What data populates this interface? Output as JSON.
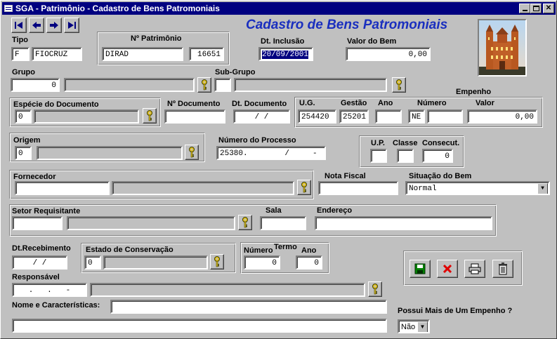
{
  "window": {
    "title": "SGA - Patrimônio - Cadastro de Bens Patromoniais"
  },
  "heading": "Cadastro de Bens Patromoniais",
  "fields": {
    "tipo_label": "Tipo",
    "tipo_code": "F",
    "tipo_name": "FIOCRUZ",
    "patrimonio_label": "Nº Patrimônio",
    "patrimonio_unit": "DIRAD",
    "patrimonio_num": "16651",
    "dt_inclusao_label": "Dt. Inclusão",
    "dt_inclusao": "20/09/2001",
    "valor_bem_label": "Valor do Bem",
    "valor_bem": "0,00",
    "grupo_label": "Grupo",
    "grupo_code": "0",
    "subgrupo_label": "Sub-Grupo",
    "especie_label": "Espécie do Documento",
    "especie_code": "0",
    "ndoc_label": "Nº Documento",
    "dtdoc_label": "Dt. Documento",
    "dtdoc": "/ /",
    "empenho_label": "Empenho",
    "ug_label": "U.G.",
    "ug": "254420",
    "gestao_label": "Gestão",
    "gestao": "25201",
    "ano_label": "Ano",
    "numero_label": "Número",
    "numero_prefix": "NE",
    "valor_label": "Valor",
    "valor": "0,00",
    "origem_label": "Origem",
    "origem_code": "0",
    "processo_label": "Número do Processo",
    "processo": "25380.        /     -",
    "up_label": "U.P.",
    "classe_label": "Classe",
    "consecut_label": "Consecut.",
    "consecut": "0",
    "fornecedor_label": "Fornecedor",
    "nota_label": "Nota Fiscal",
    "situacao_label": "Situação do Bem",
    "situacao": "Normal",
    "setor_label": "Setor Requisitante",
    "sala_label": "Sala",
    "endereco_label": "Endereço",
    "dtreceb_label": "Dt.Recebimento",
    "dtreceb": "/ /",
    "estado_label": "Estado de Conservação",
    "estado_code": "0",
    "termo_label": "Termo",
    "termo_numero_label": "Número",
    "termo_numero": "0",
    "termo_ano_label": "Ano",
    "termo_ano": "0",
    "responsavel_label": "Responsável",
    "responsavel_cpf": ".   .   -",
    "nome_label": "Nome e Características:",
    "possui_label": "Possui Mais de Um Empenho ?",
    "possui": "Não"
  },
  "icons": {
    "first": "first-record-icon",
    "prev": "previous-record-icon",
    "next": "next-record-icon",
    "last": "last-record-icon",
    "key": "key-lookup-icon",
    "save": "save-disk-icon",
    "cancel": "cancel-x-icon",
    "print": "printer-icon",
    "delete": "trash-icon"
  },
  "colors": {
    "title_bar": "#000080",
    "heading": "#1a2fbf",
    "cancel": "#e00000",
    "save": "#008000"
  }
}
